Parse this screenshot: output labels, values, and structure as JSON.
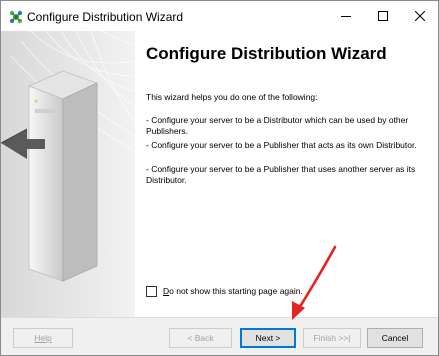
{
  "window": {
    "title": "Configure Distribution Wizard",
    "app_icon": "sql-server-wizard-icon",
    "controls": {
      "minimize_icon": "minimize-icon",
      "maximize_icon": "maximize-icon",
      "close_icon": "close-icon"
    }
  },
  "main": {
    "heading": "Configure Distribution Wizard",
    "intro": "This wizard helps you do one of the following:",
    "bullets": [
      "- Configure your server to be a Distributor which can be used by other Publishers.",
      "- Configure your server to be a Publisher that acts as its own Distributor.",
      "- Configure your server to be a Publisher that uses another server as its Distributor."
    ],
    "checkbox": {
      "label_underlined": "D",
      "label_rest": "o not show this starting page again.",
      "checked": false
    }
  },
  "footer": {
    "help": "Help",
    "back": "< Back",
    "next": "Next >",
    "finish": "Finish >>|",
    "cancel": "Cancel"
  },
  "annotation": {
    "color": "#e8231f"
  }
}
